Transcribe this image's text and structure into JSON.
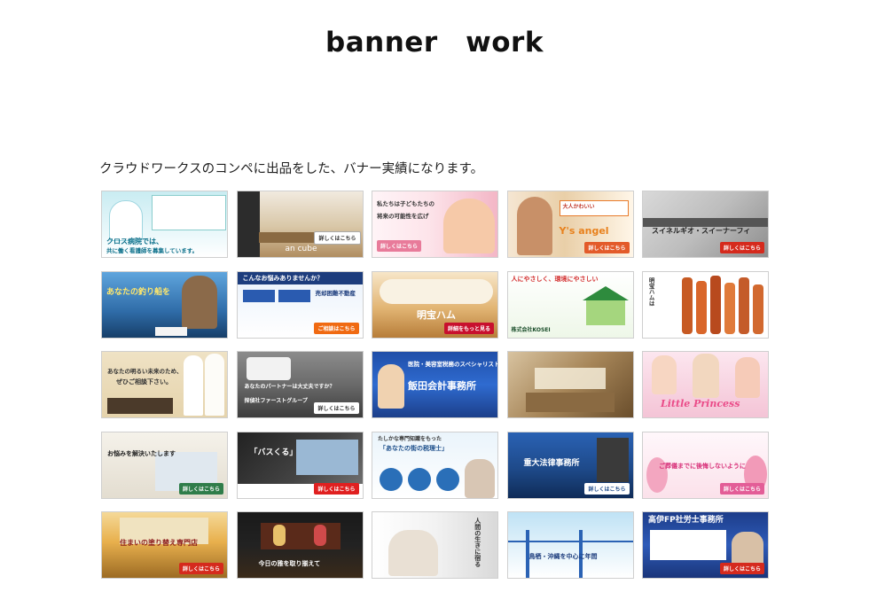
{
  "header": {
    "title": "banner　work"
  },
  "intro": {
    "text": "クラウドワークスのコンペに出品をした、バナー実績になります。"
  },
  "colors": {
    "background": "#ffffff",
    "title": "#111111",
    "text": "#222222"
  },
  "banners": [
    {
      "main": "クロス病院では、",
      "sub": "共に働く看護師を募集しています。",
      "cta": ""
    },
    {
      "main": "an cube",
      "sub": "",
      "cta": "詳しくはこちら"
    },
    {
      "main": "私たちは子どもたちの",
      "sub": "将来の可能性を広げ",
      "cta": "詳しくはこちら"
    },
    {
      "main": "Y's angel",
      "sub": "大人かわいい",
      "cta": "詳しくはこちら"
    },
    {
      "main": "スイネルギオ・スイーナーフィ",
      "sub": "",
      "cta": "詳しくはこちら"
    },
    {
      "main": "あなたの釣り船を",
      "sub": "",
      "cta": ""
    },
    {
      "main": "こんなお悩みありませんか？",
      "sub": "売却困難不動産",
      "cta": "ご相談はこちら"
    },
    {
      "main": "明宝ハム",
      "sub": "",
      "cta": "詳細をもっと見る"
    },
    {
      "main": "人にやさしく、環境にやさしい",
      "sub": "株式会社KOSEI",
      "cta": ""
    },
    {
      "main": "明宝ハムは",
      "sub": "",
      "cta": ""
    },
    {
      "main": "あなたの明るい未来のため、",
      "sub": "ぜひご相談下さい。",
      "cta": ""
    },
    {
      "main": "あなたのパートナーは大丈夫ですか？",
      "sub": "探偵社ファーストグループ",
      "cta": "詳しくはこちら"
    },
    {
      "main": "飯田会計事務所",
      "sub": "医院・美容室税務のスペシャリスト",
      "cta": ""
    },
    {
      "main": "",
      "sub": "",
      "cta": ""
    },
    {
      "main": "Little Princess",
      "sub": "",
      "cta": ""
    },
    {
      "main": "お悩みを解決いたします",
      "sub": "",
      "cta": "詳しくはこちら"
    },
    {
      "main": "「バスくる」",
      "sub": "",
      "cta": "詳しくはこちら"
    },
    {
      "main": "「あなたの街の税理士」",
      "sub": "たしかな専門知識をもった",
      "cta": ""
    },
    {
      "main": "重大法律事務所",
      "sub": "",
      "cta": "詳しくはこちら"
    },
    {
      "main": "ご葬儀までに後悔しないように",
      "sub": "",
      "cta": "詳しくはこちら"
    },
    {
      "main": "住まいの塗り替え専門店",
      "sub": "",
      "cta": "詳しくはこちら"
    },
    {
      "main": "今日の雅を取り揃えて",
      "sub": "",
      "cta": ""
    },
    {
      "main": "人間の生きに宿る",
      "sub": "",
      "cta": ""
    },
    {
      "main": "鳥栖・沖縄を中心に年間",
      "sub": "",
      "cta": ""
    },
    {
      "main": "高伊FP社労士事務所",
      "sub": "",
      "cta": "詳しくはこちら"
    }
  ]
}
